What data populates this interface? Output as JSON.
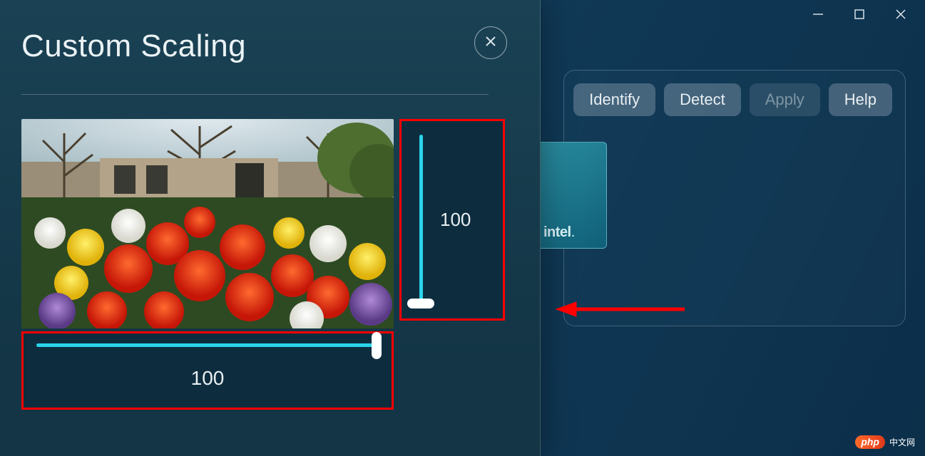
{
  "window": {
    "minimize_title": "Minimize",
    "maximize_title": "Maximize",
    "close_title": "Close"
  },
  "toolbar": {
    "identify": "Identify",
    "detect": "Detect",
    "apply": "Apply",
    "help": "Help"
  },
  "brand": {
    "name": "intel"
  },
  "modal": {
    "title": "Custom Scaling",
    "close_title": "Close"
  },
  "scaling": {
    "vertical_value": "100",
    "horizontal_value": "100"
  },
  "watermark": {
    "brand": "php",
    "text": "中文网"
  }
}
